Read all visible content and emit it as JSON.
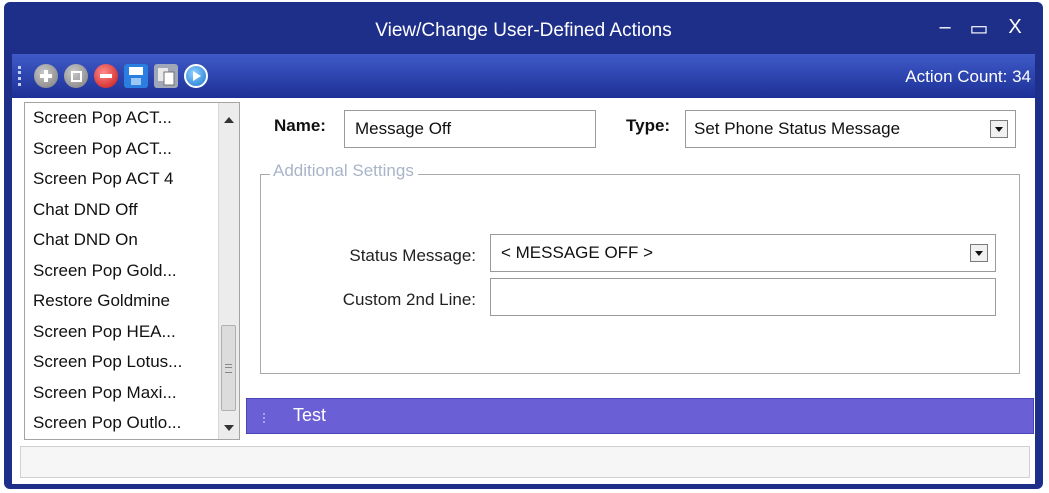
{
  "window": {
    "title": "View/Change User-Defined Actions",
    "minimize_glyph": "–",
    "maximize_glyph": "▭",
    "close_glyph": "X"
  },
  "toolbar": {
    "buttons": [
      "add-icon",
      "copy-icon",
      "delete-icon",
      "save-icon",
      "import-icon",
      "run-icon"
    ],
    "action_count_label": "Action Count: 34"
  },
  "action_list": {
    "items": [
      {
        "label": "Screen Pop ACT..."
      },
      {
        "label": "Screen Pop ACT..."
      },
      {
        "label": "Screen Pop ACT 4"
      },
      {
        "label": "Chat DND Off"
      },
      {
        "label": "Chat DND On"
      },
      {
        "label": "Screen Pop Gold..."
      },
      {
        "label": "Restore Goldmine"
      },
      {
        "label": "Screen Pop HEA..."
      },
      {
        "label": "Screen Pop Lotus..."
      },
      {
        "label": "Screen Pop Maxi..."
      },
      {
        "label": "Screen Pop Outlo..."
      }
    ]
  },
  "form": {
    "name_label": "Name:",
    "name_value": "Message Off",
    "type_label": "Type:",
    "type_value": "Set Phone Status Message"
  },
  "additional_settings": {
    "legend": "Additional Settings",
    "status_message_label": "Status Message:",
    "status_message_value": "< MESSAGE OFF >",
    "custom_line_label": "Custom 2nd Line:",
    "custom_line_value": ""
  },
  "test_panel": {
    "label": "Test"
  },
  "colors": {
    "title_bar": "#1e2f8a",
    "toolbar": "#2e46b4",
    "test_bar": "#6a5fd4"
  }
}
